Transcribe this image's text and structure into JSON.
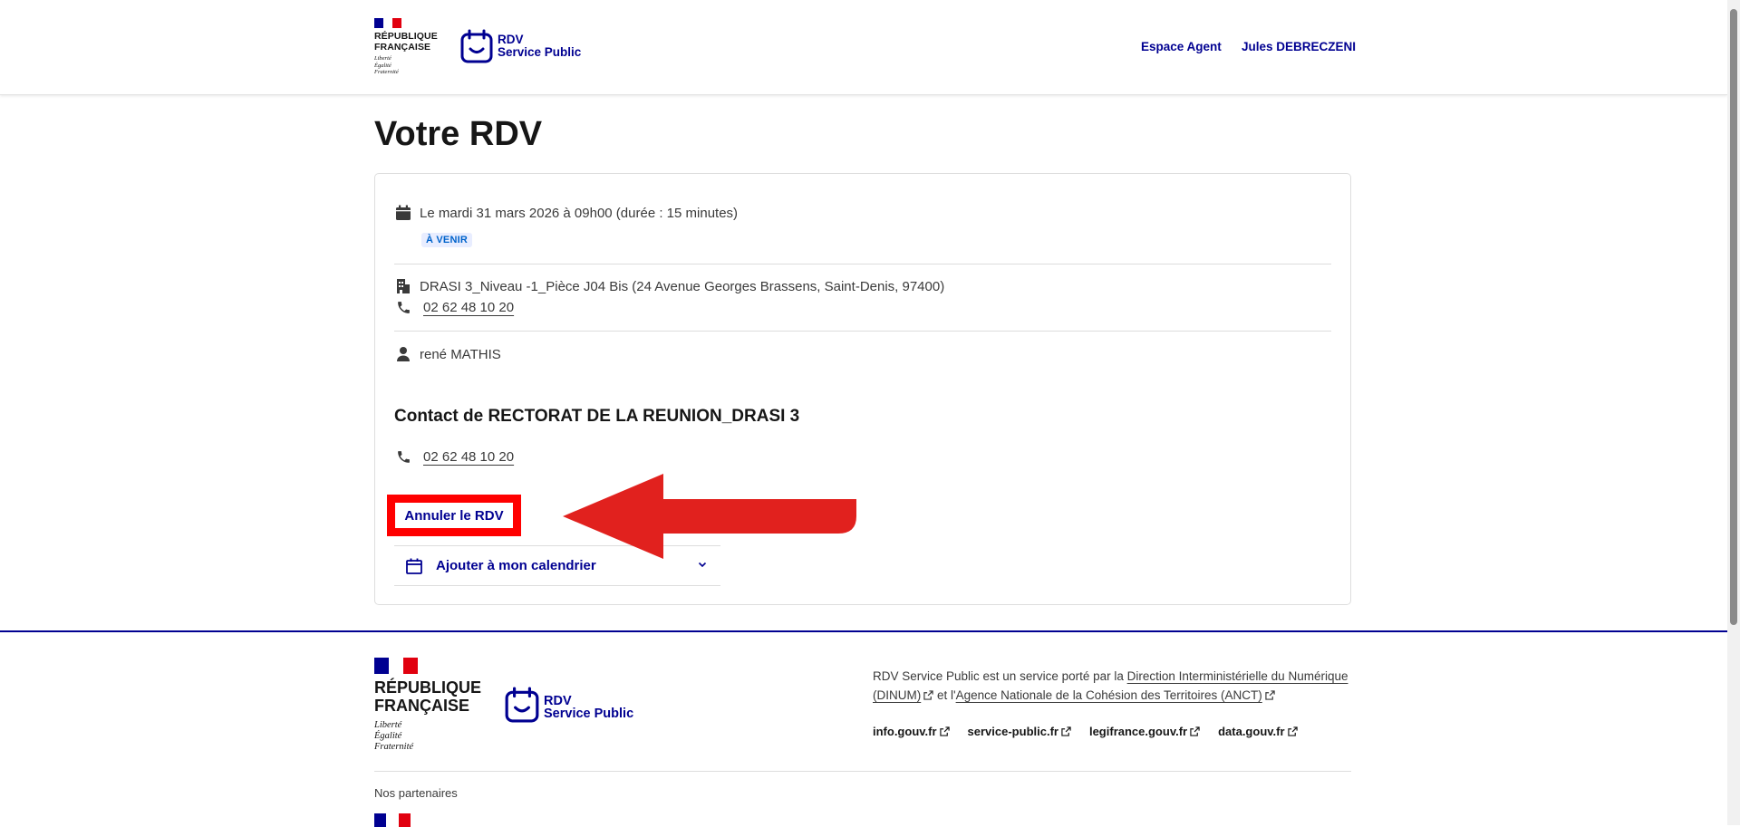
{
  "header": {
    "republic_name_line1": "RÉPUBLIQUE",
    "republic_name_line2": "FRANÇAISE",
    "motto": [
      "Liberté",
      "Égalité",
      "Fraternité"
    ],
    "brand_line1": "RDV",
    "brand_line2": "Service Public",
    "nav": [
      "Espace Agent",
      "Jules DEBRECZENI"
    ]
  },
  "page": {
    "title": "Votre RDV"
  },
  "rdv": {
    "datetime": "Le mardi 31 mars 2026 à 09h00 (durée : 15 minutes)",
    "status_badge": "À VENIR",
    "location": "DRASI 3_Niveau -1_Pièce J04 Bis (24 Avenue Georges Brassens, Saint-Denis, 97400)",
    "location_phone": "02 62 48 10 20",
    "person": "rené MATHIS",
    "contact_title": "Contact de RECTORAT DE LA REUNION_DRASI 3",
    "contact_phone": "02 62 48 10 20",
    "cancel_label": "Annuler le RDV",
    "calendar_label": "Ajouter à mon calendrier"
  },
  "footer": {
    "republic_name_line1": "RÉPUBLIQUE",
    "republic_name_line2": "FRANÇAISE",
    "motto": [
      "Liberté",
      "Égalité",
      "Fraternité"
    ],
    "brand_line1": "RDV",
    "brand_line2": "Service Public",
    "desc_prefix": "RDV Service Public est un service porté par la ",
    "desc_link1": "Direction Interministérielle du Numérique (DINUM)",
    "desc_middle": " et l'",
    "desc_link2": "Agence Nationale de la Cohésion des Territoires (ANCT)",
    "links": [
      "info.gouv.fr",
      "service-public.fr",
      "legifrance.gouv.fr",
      "data.gouv.fr"
    ],
    "partners_label": "Nos partenaires"
  },
  "colors": {
    "primary": "#000091",
    "highlight": "#ff0000",
    "arrow": "#e1211e",
    "flag_blue": "#000091",
    "flag_red": "#e1000f"
  },
  "icons": [
    "calendar-icon",
    "building-icon",
    "phone-icon",
    "user-icon",
    "chevron-down-icon",
    "external-link-icon"
  ]
}
